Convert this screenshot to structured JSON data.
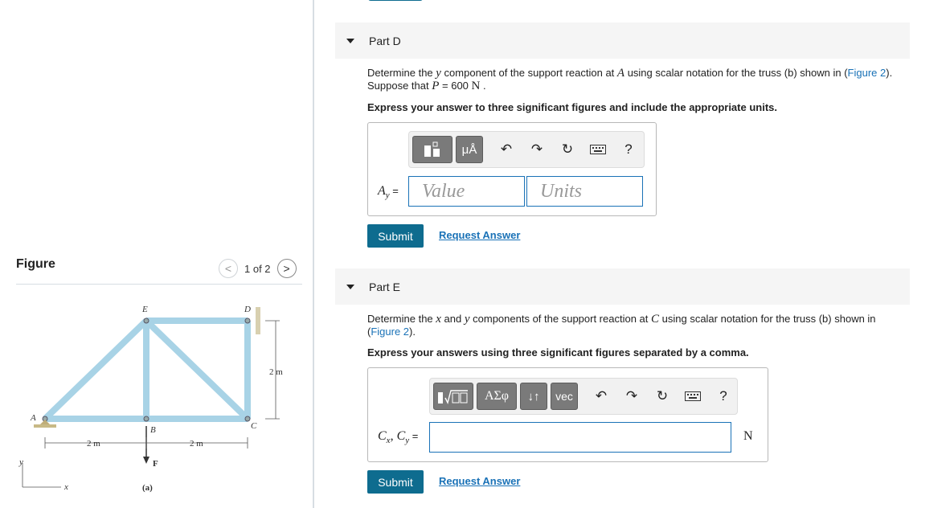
{
  "figure": {
    "heading": "Figure",
    "pager_text": "1 of 2",
    "prev_symbol": "<",
    "next_symbol": ">",
    "labels": {
      "A": "A",
      "B": "B",
      "C": "C",
      "D": "D",
      "E": "E",
      "F": "F",
      "dim_h1": "2 m",
      "dim_h2": "2 m",
      "dim_v": "2 m",
      "axis_x": "x",
      "axis_y": "y",
      "caption": "(a)"
    }
  },
  "partD": {
    "title": "Part D",
    "prompt_1": "Determine the ",
    "prompt_var": "y",
    "prompt_2": " component of the support reaction at ",
    "prompt_point": "A",
    "prompt_3": " using scalar notation for the truss (b) shown in (",
    "prompt_link": "Figure 2",
    "prompt_4": ").",
    "prompt_5": "Suppose that ",
    "prompt_P": "P",
    "prompt_6": " = 600 ",
    "prompt_unit": "N",
    "prompt_7": " .",
    "instruction": "Express your answer to three significant figures and include the appropriate units.",
    "var_label": "A",
    "var_sub": "y",
    "eq": " =",
    "value_placeholder": "Value",
    "units_placeholder": "Units",
    "toolbar": {
      "units_btn": "μÅ",
      "undo": "↶",
      "redo": "↷",
      "reset": "↻",
      "help": "?"
    },
    "submit": "Submit",
    "request": "Request Answer"
  },
  "partE": {
    "title": "Part E",
    "prompt_1": "Determine the ",
    "prompt_var_x": "x",
    "prompt_2": " and ",
    "prompt_var_y": "y",
    "prompt_3": " components of the support reaction at ",
    "prompt_point": "C",
    "prompt_4": " using scalar notation for the truss (b) shown in",
    "prompt_5": "(",
    "prompt_link": "Figure 2",
    "prompt_6": ").",
    "instruction": "Express your answers using three significant figures separated by a comma.",
    "var_label": "C",
    "var_sub_x": "x",
    "comma": ", ",
    "var_label_2": "C",
    "var_sub_y": "y",
    "eq": " =",
    "unit": "N",
    "toolbar": {
      "greek_btn": "ΑΣφ",
      "arrows_btn": "↓↑",
      "vec_btn": "vec",
      "undo": "↶",
      "redo": "↷",
      "reset": "↻",
      "help": "?"
    },
    "submit": "Submit",
    "request": "Request Answer"
  },
  "colors": {
    "accent": "#0e6c8f",
    "link": "#1a72b7",
    "member": "#a8d3e6"
  }
}
